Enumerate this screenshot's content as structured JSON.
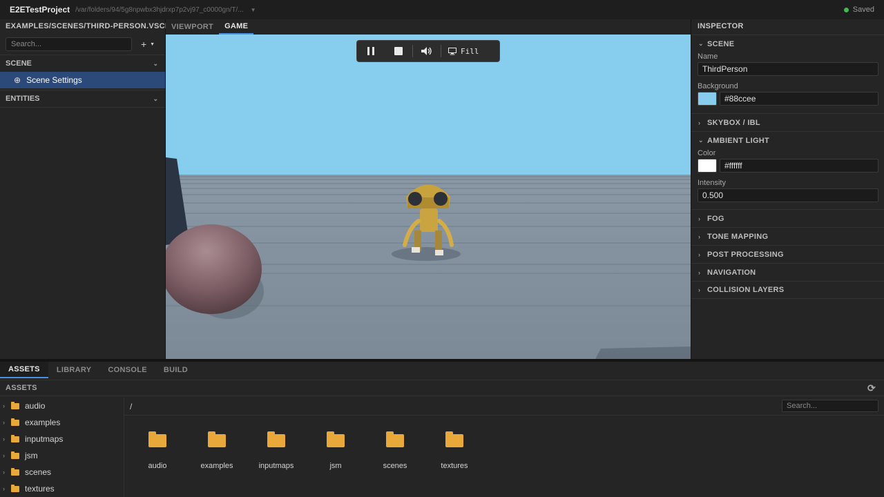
{
  "titlebar": {
    "app_name": "E2ETestProject",
    "path": "/var/folders/94/5g8npwbx3hjdrxp7p2vj97_c0000gn/T/...",
    "status": "Saved",
    "status_color": "#3fb950"
  },
  "scene_panel": {
    "scene_path": "EXAMPLES/SCENES/THIRD-PERSON.VSCN",
    "search_placeholder": "Search...",
    "add_label": "+",
    "sections": {
      "scene": "SCENE",
      "entities": "ENTITIES"
    },
    "selected_item": "Scene Settings"
  },
  "viewport_tabs": {
    "viewport": "VIEWPORT",
    "game": "GAME",
    "active": "GAME"
  },
  "playbar": {
    "pause_icon": "pause-icon",
    "stop_icon": "stop-icon",
    "volume_icon": "volume-icon",
    "display_icon": "monitor-icon",
    "fill_label": "Fill"
  },
  "inspector": {
    "title": "INSPECTOR",
    "scene_section": "SCENE",
    "name_label": "Name",
    "name_value": "ThirdPerson",
    "background_label": "Background",
    "background_value": "#88ccee",
    "skybox_section": "SKYBOX / IBL",
    "ambient_section": "AMBIENT LIGHT",
    "color_label": "Color",
    "color_value": "#ffffff",
    "intensity_label": "Intensity",
    "intensity_value": "0.500",
    "fog_section": "FOG",
    "tone_mapping_section": "TONE MAPPING",
    "post_processing_section": "POST PROCESSING",
    "navigation_section": "NAVIGATION",
    "collision_layers_section": "COLLISION LAYERS"
  },
  "bottom_tabs": [
    "ASSETS",
    "LIBRARY",
    "CONSOLE",
    "BUILD"
  ],
  "assets": {
    "header": "ASSETS",
    "breadcrumb": "/",
    "search_placeholder": "Search...",
    "tree": [
      "audio",
      "examples",
      "inputmaps",
      "jsm",
      "scenes",
      "textures"
    ],
    "grid": [
      "audio",
      "examples",
      "inputmaps",
      "jsm",
      "scenes",
      "textures"
    ]
  },
  "colors": {
    "accent": "#4a90e2",
    "selection": "#2c4a79",
    "folder": "#e8a93a",
    "sky": "#87ceee"
  }
}
